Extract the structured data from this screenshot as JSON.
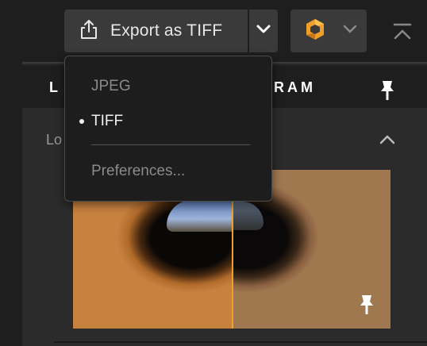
{
  "toolbar": {
    "export_label": "Export as TIFF",
    "icons": {
      "export": "share-export-icon",
      "dropdown": "chevron-down-icon",
      "plugin": "aperture-icon",
      "collapse": "collapse-up-icon"
    }
  },
  "panel": {
    "header_left": "L",
    "header_tab": "RAM",
    "loupe_label": "Lo"
  },
  "export_menu": {
    "items": [
      {
        "label": "JPEG",
        "selected": false
      },
      {
        "label": "TIFF",
        "selected": true
      },
      {
        "label": "Preferences...",
        "selected": false
      }
    ]
  },
  "colors": {
    "accent": "#f0a02a",
    "panel_bg": "#1e1e1e",
    "button_bg": "#3a3a3a"
  }
}
